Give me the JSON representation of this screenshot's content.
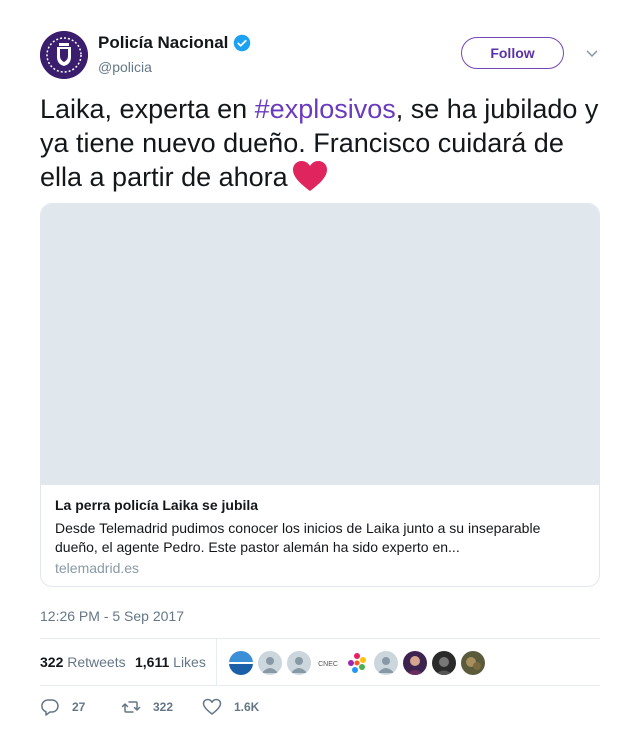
{
  "author": {
    "name": "Policía Nacional",
    "handle": "@policia",
    "verified": true,
    "follow_label": "Follow"
  },
  "tweet": {
    "text_before": "Laika, experta en ",
    "hashtag": "#explosivos",
    "text_after": ", se ha jubilado y ya tiene nuevo dueño. Francisco cuidará de ella a partir de ahora",
    "emoji": "red-heart-icon"
  },
  "card": {
    "title": "La perra policía Laika se jubila",
    "description": "Desde Telemadrid pudimos conocer los inicios de Laika junto a su inseparable dueño, el agente Pedro. Este pastor alemán ha sido experto en...",
    "domain": "telemadrid.es"
  },
  "timestamp": "12:26 PM - 5 Sep 2017",
  "stats": {
    "retweets_count": "322",
    "retweets_label": "Retweets",
    "likes_count": "1,611",
    "likes_label": "Likes",
    "liker_avatars": [
      "avatar-1",
      "avatar-2",
      "avatar-3",
      "avatar-4",
      "avatar-5",
      "avatar-6",
      "avatar-7",
      "avatar-8",
      "avatar-9"
    ],
    "cnec_label": "CNEC"
  },
  "actions": {
    "replies": "27",
    "retweets": "322",
    "likes": "1.6K"
  },
  "colors": {
    "accent": "#6a3bbd",
    "verified": "#1da1f2",
    "heart": "#e0245e"
  }
}
